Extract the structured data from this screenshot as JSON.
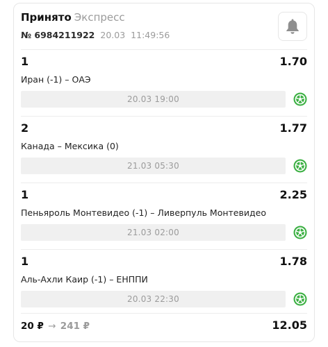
{
  "header": {
    "status": "Принято",
    "bet_type": "Экспресс",
    "bet_number": "№ 6984211922",
    "date": "20.03",
    "time": "11:49:56",
    "bell_icon": "bell-icon"
  },
  "events": [
    {
      "outcome": "1",
      "coefficient": "1.70",
      "match": "Иран (-1) – ОАЭ",
      "start": "20.03 19:00",
      "sport_icon": "football-icon"
    },
    {
      "outcome": "2",
      "coefficient": "1.77",
      "match": "Канада – Мексика (0)",
      "start": "21.03 05:30",
      "sport_icon": "football-icon"
    },
    {
      "outcome": "1",
      "coefficient": "2.25",
      "match": "Пеньяроль Монтевидео (-1) – Ливерпуль Монтевидео",
      "start": "21.03 02:00",
      "sport_icon": "football-icon"
    },
    {
      "outcome": "1",
      "coefficient": "1.78",
      "match": "Аль-Ахли Каир (-1) – ЕНППИ",
      "start": "20.03 22:30",
      "sport_icon": "football-icon"
    }
  ],
  "footer": {
    "stake": "20 ₽",
    "arrow": "→",
    "payout": "241 ₽",
    "total_coefficient": "12.05"
  },
  "colors": {
    "muted": "#9b9b9b",
    "sport_icon": "#3cb043",
    "date_bar_bg": "#f0f0f0"
  }
}
